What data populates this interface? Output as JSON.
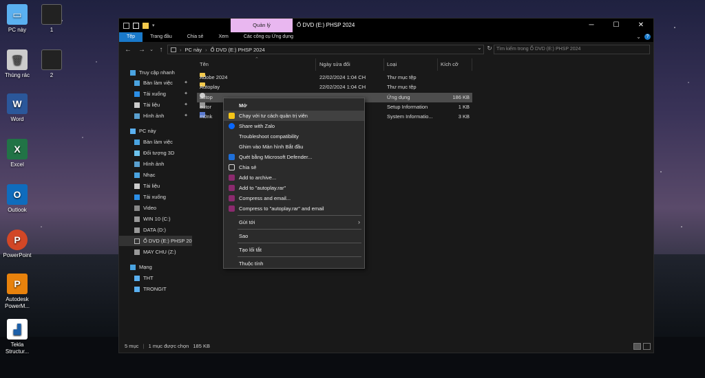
{
  "desktop": {
    "icons": [
      {
        "label": "PC này"
      },
      {
        "label": "1"
      },
      {
        "label": "Thùng rác"
      },
      {
        "label": "2"
      },
      {
        "label": "Word"
      },
      {
        "label": "Excel"
      },
      {
        "label": "Outlook"
      },
      {
        "label": "PowerPoint"
      },
      {
        "label": "Autodesk PowerM..."
      },
      {
        "label": "Tekla Structur..."
      }
    ]
  },
  "window": {
    "title": "Ổ DVD (E:) PHSP 2024",
    "contextual_tab": "Quản lý",
    "ribbon_tabs": [
      "Tệp",
      "Trang đầu",
      "Chia sẻ",
      "Xem",
      "Các công cụ Ứng dụng"
    ],
    "address": [
      "PC này",
      "Ổ DVD (E:) PHSP 2024"
    ],
    "search_placeholder": "Tìm kiếm trong Ổ DVD (E:) PHSP 2024",
    "columns": [
      "Tên",
      "Ngày sửa đổi",
      "Loại",
      "Kích cỡ"
    ],
    "status": {
      "count": "5 mục",
      "selected": "1 mục được chọn",
      "size": "185 KB"
    }
  },
  "nav": [
    {
      "label": "Truy cập nhanh",
      "icon": "star-icon"
    },
    {
      "label": "Bàn làm việc",
      "icon": "desktop-icon",
      "pinned": true
    },
    {
      "label": "Tải xuống",
      "icon": "download-icon",
      "pinned": true
    },
    {
      "label": "Tài liệu",
      "icon": "document-icon",
      "pinned": true
    },
    {
      "label": "Hình ảnh",
      "icon": "picture-icon",
      "pinned": true
    },
    {
      "label": "PC này",
      "icon": "pc-icon"
    },
    {
      "label": "Bàn làm việc",
      "icon": "desktop-icon"
    },
    {
      "label": "Đối tượng 3D",
      "icon": "cube-icon"
    },
    {
      "label": "Hình ảnh",
      "icon": "picture-icon"
    },
    {
      "label": "Nhạc",
      "icon": "music-icon"
    },
    {
      "label": "Tài liệu",
      "icon": "document-icon"
    },
    {
      "label": "Tải xuống",
      "icon": "download-icon"
    },
    {
      "label": "Video",
      "icon": "video-icon"
    },
    {
      "label": "WIN 10 (C:)",
      "icon": "drive-icon"
    },
    {
      "label": "DATA (D:)",
      "icon": "drive-icon"
    },
    {
      "label": "Ổ DVD (E:) PHSP 20",
      "icon": "dvd-icon"
    },
    {
      "label": "MAY CHU (Z:)",
      "icon": "network-drive-icon"
    },
    {
      "label": "Mạng",
      "icon": "network-icon"
    },
    {
      "label": "THT",
      "icon": "computer-icon"
    },
    {
      "label": "TRONGIT",
      "icon": "computer-icon"
    }
  ],
  "files": [
    {
      "name": "Adobe 2024",
      "date": "22/02/2024 1:04 CH",
      "type": "Thư mục tệp",
      "size": "",
      "icon": "folder-icon"
    },
    {
      "name": "Autoplay",
      "date": "22/02/2024 1:04 CH",
      "type": "Thư mục tệp",
      "size": "",
      "icon": "folder-icon"
    },
    {
      "name": "autop",
      "date": "",
      "type": "Ứng dụng",
      "size": "186 KB",
      "icon": "app-icon"
    },
    {
      "name": "autor",
      "date": "",
      "type": "Setup Information",
      "size": "1 KB",
      "icon": "settings-file-icon"
    },
    {
      "name": "m0nk",
      "date": "",
      "type": "System Informatio...",
      "size": "3 KB",
      "icon": "sysinfo-file-icon"
    }
  ],
  "context_menu": [
    {
      "label": "Mở"
    },
    {
      "label": "Chạy với tư cách quản trị viên",
      "icon": "shield-icon",
      "color": "#f5c518"
    },
    {
      "label": "Share with Zalo",
      "icon": "zalo-icon",
      "color": "#0a68ff"
    },
    {
      "label": "Troubleshoot compatibility"
    },
    {
      "label": "Ghim vào Màn hình Bắt đầu"
    },
    {
      "label": "Quét bằng Microsoft Defender...",
      "icon": "defender-icon",
      "color": "#1e6fd9"
    },
    {
      "label": "Chia sẻ",
      "icon": "share-icon",
      "color": "#ddd"
    },
    {
      "label": "Add to archive...",
      "icon": "winrar-icon",
      "color": "#8b2a6e"
    },
    {
      "label": "Add to \"autoplay.rar\"",
      "icon": "winrar-icon",
      "color": "#8b2a6e"
    },
    {
      "label": "Compress and email...",
      "icon": "winrar-icon",
      "color": "#8b2a6e"
    },
    {
      "label": "Compress to \"autoplay.rar\" and email",
      "icon": "winrar-icon",
      "color": "#8b2a6e"
    },
    {
      "label": "Gửi tới"
    },
    {
      "label": "Sao"
    },
    {
      "label": "Tạo lối tắt"
    },
    {
      "label": "Thuộc tính"
    }
  ],
  "colors": {
    "accent": "#1979ca",
    "contextual_tab": "#e9b7f0",
    "folder": "#f2c94c"
  }
}
